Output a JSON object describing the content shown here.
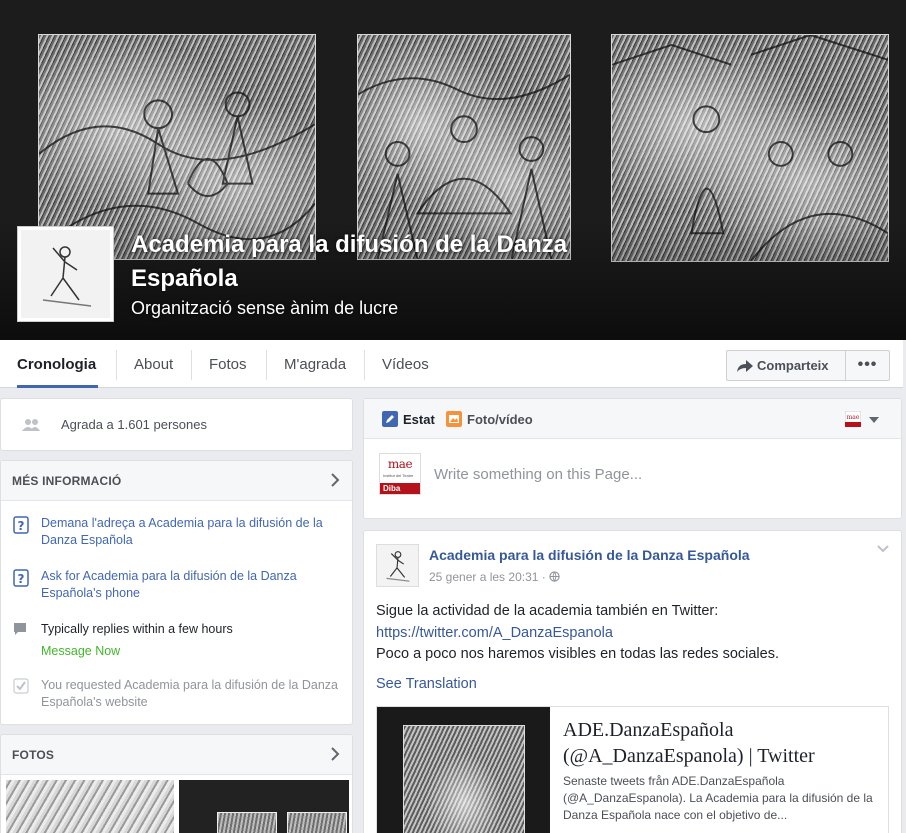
{
  "page": {
    "name": "Academia para la difusión de la Danza Española",
    "category": "Organització sense ànim de lucre"
  },
  "tabs": [
    {
      "label": "Cronologia",
      "active": true
    },
    {
      "label": "About"
    },
    {
      "label": "Fotos"
    },
    {
      "label": "M'agrada"
    },
    {
      "label": "Vídeos"
    }
  ],
  "actions": {
    "share_label": "Comparteix",
    "more_label": "•••"
  },
  "sidebar": {
    "likes_text": "Agrada a 1.601 persones",
    "more_info": {
      "title": "MÉS INFORMACIÓ",
      "items": [
        {
          "text": "Demana l'adreça a Academia para la difusión de la Danza Española"
        },
        {
          "text": "Ask for Academia para la difusión de la Danza Española's phone"
        },
        {
          "text": "Typically replies within a few hours",
          "action": "Message Now"
        },
        {
          "text": "You requested Academia para la difusión de la Danza Española's website"
        }
      ]
    },
    "photos": {
      "title": "FOTOS"
    }
  },
  "composer": {
    "tab_status": "Estat",
    "tab_photo": "Foto/vídeo",
    "placeholder": "Write something on this Page...",
    "logo": {
      "text": "mae",
      "subtitle": "Institut del Teatre",
      "bar": "Diba"
    }
  },
  "post": {
    "author": "Academia para la difusión de la Danza Española",
    "time": "25 gener a les 20:31",
    "text": [
      "Sigue la actividad de la academia también en Twitter:",
      "https://twitter.com/A_DanzaEspanola",
      "Poco a poco nos haremos visibles en todas las redes sociales."
    ],
    "see_translation": "See Translation",
    "attachment": {
      "title": "ADE.DanzaEspañola (@A_DanzaEspanola) | Twitter",
      "description": "Senaste tweets från ADE.DanzaEspañola (@A_DanzaEspanola). La Academia para la difusión de la Danza Española nace con el objetivo de..."
    }
  },
  "colors": {
    "accent": "#4267b2",
    "link": "#365899",
    "green": "#42b72a",
    "mae_red": "#b5121b"
  }
}
